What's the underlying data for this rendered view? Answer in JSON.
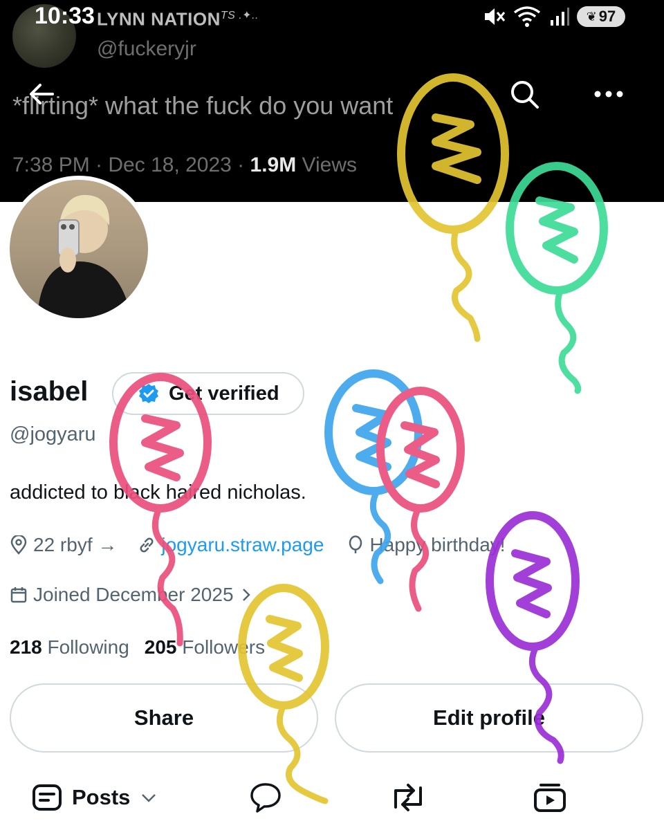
{
  "status_bar": {
    "time": "10:33",
    "battery": "97"
  },
  "banner": {
    "display_name": "LYNN NATION",
    "display_name_suffix": "TS .✦..",
    "handle": "@fuckeryjr",
    "tweet_text": "*flirting* what the fuck do you want",
    "tweet_time": "7:38 PM · Dec 18, 2023 · ",
    "tweet_views_count": "1.9M",
    "tweet_views_label": " Views"
  },
  "header": {
    "back_icon": "arrow-left-icon",
    "search_icon": "search-icon",
    "more_icon": "more-icon"
  },
  "profile": {
    "name": "isabel",
    "verify_label": "Get verified",
    "handle": "@jogyaru",
    "bio": "addicted to black haired nicholas.",
    "location": "22 rbyf →",
    "website": "jogyaru.straw.page",
    "birthday": "Happy birthday!",
    "joined": "Joined December 2025",
    "following_count": "218",
    "following_label": "Following",
    "followers_count": "205",
    "followers_label": "Followers"
  },
  "actions": {
    "share_label": "Share",
    "edit_label": "Edit profile"
  },
  "tabs": {
    "posts_label": "Posts"
  },
  "colors": {
    "accent": "#1d9bf0",
    "balloon_yellow": "#e3c530",
    "balloon_green": "#3ddc97",
    "balloon_pink": "#ea4f7c",
    "balloon_blue": "#3ea5ec",
    "balloon_purple": "#9b2fd6"
  }
}
